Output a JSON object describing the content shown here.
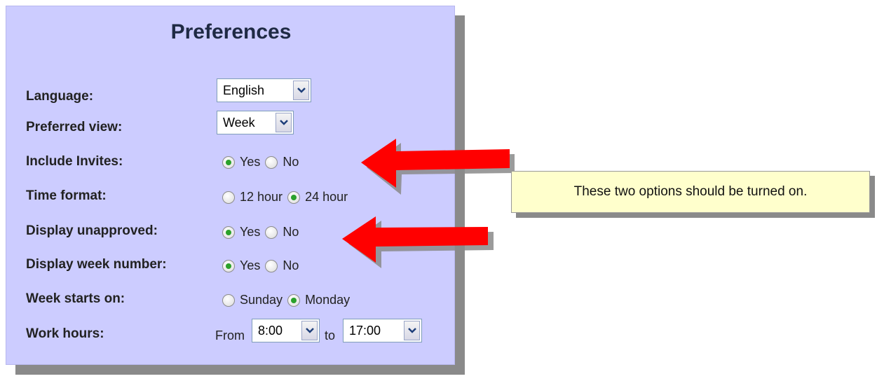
{
  "panel": {
    "title": "Preferences"
  },
  "rows": {
    "language": {
      "label": "Language:",
      "value": "English"
    },
    "preferred_view": {
      "label": "Preferred view:",
      "value": "Week"
    },
    "include_invites": {
      "label": "Include Invites:",
      "yes": "Yes",
      "no": "No",
      "selected": "Yes"
    },
    "time_format": {
      "label": "Time format:",
      "opt1": "12 hour",
      "opt2": "24 hour",
      "selected": "24 hour"
    },
    "display_unapproved": {
      "label": "Display unapproved:",
      "yes": "Yes",
      "no": "No",
      "selected": "Yes"
    },
    "display_week_number": {
      "label": "Display week number:",
      "yes": "Yes",
      "no": "No",
      "selected": "Yes"
    },
    "week_starts_on": {
      "label": "Week starts on:",
      "opt1": "Sunday",
      "opt2": "Monday",
      "selected": "Monday"
    },
    "work_hours": {
      "label": "Work hours:",
      "from_text": "From",
      "from_value": "8:00",
      "to_text": "to",
      "to_value": "17:00"
    }
  },
  "annotation": {
    "note": "These two options should be turned on."
  },
  "colors": {
    "panel_bg": "#ccccff",
    "arrow": "#ff0000",
    "note_bg": "#ffffcc",
    "radio_selected": "#2ba12b"
  },
  "icons": {
    "dropdown": "chevron-down-icon",
    "arrow": "left-arrow-icon"
  }
}
